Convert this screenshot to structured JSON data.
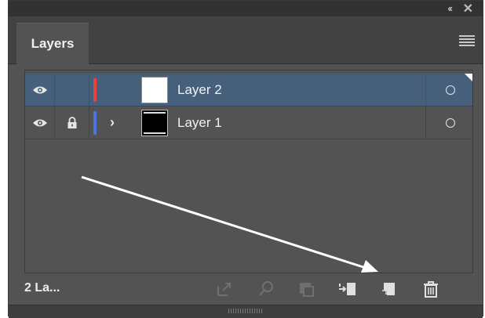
{
  "panel": {
    "tab_label": "Layers",
    "layer_count_label": "2 La..."
  },
  "layers": [
    {
      "name": "Layer 2",
      "color": "#e8413c",
      "selected": true,
      "locked": false,
      "expandable": false,
      "thumb": "white"
    },
    {
      "name": "Layer 1",
      "color": "#4a74e0",
      "selected": false,
      "locked": true,
      "expandable": true,
      "thumb": "black"
    }
  ],
  "colors": {
    "panel_bg": "#535353",
    "selection": "#46607c",
    "annotation_arrow": "#ffffff"
  },
  "footer_icons": [
    "export-icon",
    "search-icon",
    "clipping-mask-icon",
    "move-selection-icon",
    "new-layer-icon",
    "delete-icon"
  ]
}
